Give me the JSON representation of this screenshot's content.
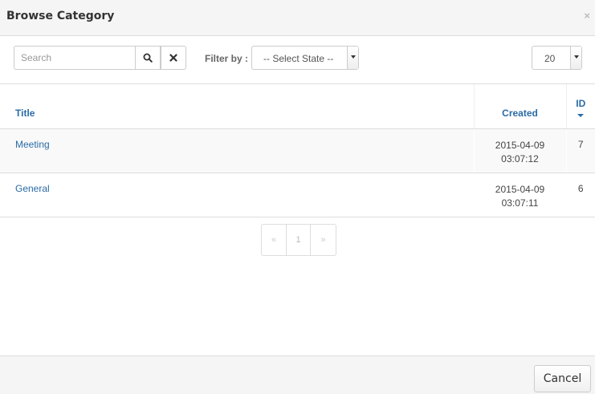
{
  "modal": {
    "title": "Browse Category",
    "close_icon": "×",
    "cancel_label": "Cancel"
  },
  "toolbar": {
    "search_placeholder": "Search",
    "search_value": "",
    "search_icon": "search-icon",
    "clear_icon": "close-icon",
    "filter_label": "Filter by :",
    "state_select": "-- Select State --",
    "limit_select": "20"
  },
  "table": {
    "columns": {
      "title": "Title",
      "created": "Created",
      "id": "ID"
    },
    "sort": {
      "column": "ID",
      "direction": "descending"
    },
    "rows": [
      {
        "title": "Meeting",
        "created_date": "2015-04-09",
        "created_time": "03:07:12",
        "id": "7"
      },
      {
        "title": "General",
        "created_date": "2015-04-09",
        "created_time": "03:07:11",
        "id": "6"
      }
    ]
  },
  "pagination": {
    "prev": "«",
    "page": "1",
    "next": "»"
  },
  "colors": {
    "link": "#2a6ba6",
    "header_bg": "#f5f5f5",
    "border": "#dddddd"
  }
}
